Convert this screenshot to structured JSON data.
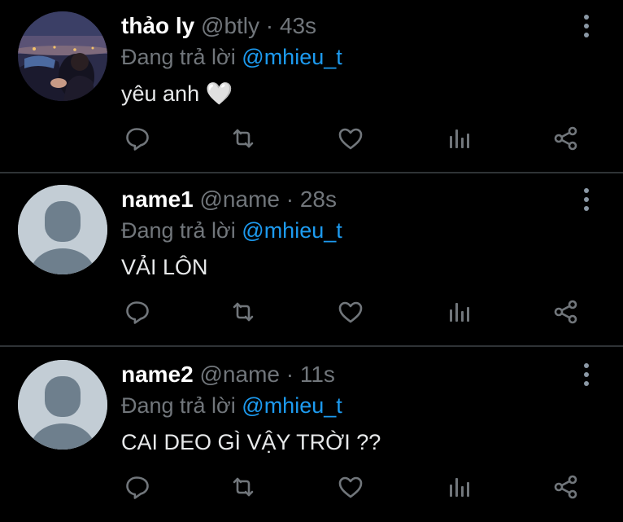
{
  "colors": {
    "background": "#000000",
    "divider": "#2f3336",
    "muted": "#71767b",
    "mention": "#1d9bf0",
    "text": "#e7e9ea"
  },
  "reply_prefix": "Đang trả lời",
  "tweets": [
    {
      "name": "thảo ly",
      "handle": "@btly",
      "separator": "·",
      "time": "43s",
      "reply_to": "@mhieu_t",
      "text": "yêu anh 🤍",
      "avatar": "photo-avatar"
    },
    {
      "name": "name1",
      "handle": "@name",
      "separator": "·",
      "time": "28s",
      "reply_to": "@mhieu_t",
      "text": "VẢI LÔN",
      "avatar": "default-avatar"
    },
    {
      "name": "name2",
      "handle": "@name",
      "separator": "·",
      "time": "11s",
      "reply_to": "@mhieu_t",
      "text": "CAI DEO GÌ VẬY TRỜI ??",
      "avatar": "default-avatar"
    }
  ],
  "action_icons": [
    "reply-icon",
    "retweet-icon",
    "like-icon",
    "stats-icon",
    "share-icon"
  ]
}
